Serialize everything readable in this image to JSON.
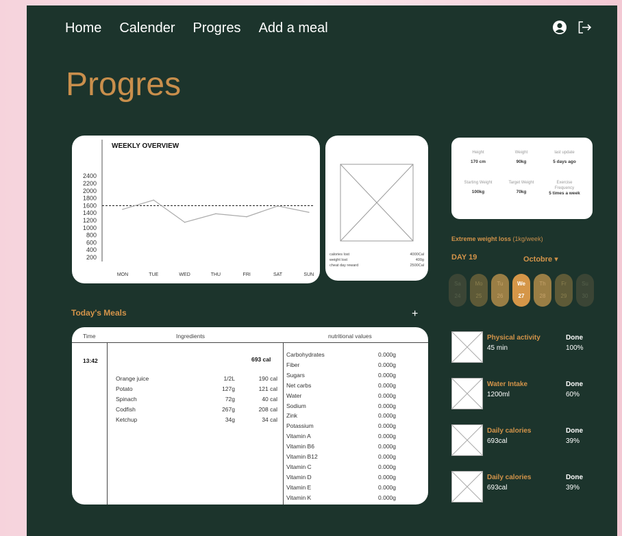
{
  "nav": {
    "items": [
      "Home",
      "Calender",
      "Progres",
      "Add a meal"
    ],
    "user_icon": "user-circle-icon",
    "logout_icon": "logout-icon"
  },
  "page_title": "Progres",
  "chart_data": {
    "type": "line",
    "title": "WEEKLY OVERVIEW",
    "categories": [
      "MON",
      "TUE",
      "WED",
      "THU",
      "FRI",
      "SAT",
      "SUN"
    ],
    "series": [
      {
        "values": [
          1500,
          1750,
          1150,
          1380,
          1300,
          1590,
          1420
        ]
      }
    ],
    "reference_line": 1600,
    "yticks": [
      200,
      400,
      600,
      800,
      1000,
      1200,
      1400,
      1600,
      1800,
      2000,
      2200,
      2400
    ],
    "ylim": [
      0,
      2400
    ]
  },
  "summary": {
    "rows": [
      {
        "label": "calories lost",
        "value": "4000Cal"
      },
      {
        "label": "weight lost",
        "value": "400g"
      },
      {
        "label": "cheat day reward",
        "value": "2500Cal"
      }
    ]
  },
  "stats": {
    "height_label": "Height",
    "height": "170 cm",
    "weight_label": "Weight",
    "weight": "90kg",
    "update_label": "last update",
    "update": "5 days ago",
    "start_label": "Starting Weight",
    "start": "100kg",
    "target_label": "Target Weight",
    "target": "70kg",
    "freq_label": "Exercise Frequency",
    "freq": "5 times a week"
  },
  "plan": {
    "name": "Extreme weight loss",
    "rate": "(1kg/week)",
    "day": "DAY 19",
    "month": "Octobre ▾",
    "days": [
      {
        "d": "Sa",
        "n": "24"
      },
      {
        "d": "Mo",
        "n": "25"
      },
      {
        "d": "Tu",
        "n": "26"
      },
      {
        "d": "We",
        "n": "27"
      },
      {
        "d": "Th",
        "n": "28"
      },
      {
        "d": "Fr",
        "n": "29"
      },
      {
        "d": "Su",
        "n": "30"
      }
    ]
  },
  "meals": {
    "title": "Today's Meals",
    "add": "+",
    "headers": {
      "time": "Time",
      "ingredients": "Ingredients",
      "nutrition": "nutritional values"
    },
    "time": "13:42",
    "total": "693 cal",
    "ingredients": [
      {
        "name": "Orange juice",
        "qty": "1/2L",
        "cal": "190 cal"
      },
      {
        "name": "Potato",
        "qty": "127g",
        "cal": "121 cal"
      },
      {
        "name": "Spinach",
        "qty": "72g",
        "cal": "40 cal"
      },
      {
        "name": "Codfish",
        "qty": "267g",
        "cal": "208 cal"
      },
      {
        "name": "Ketchup",
        "qty": "34g",
        "cal": "34 cal"
      }
    ],
    "nutrients": [
      {
        "name": "Carbohydrates",
        "value": "0.000g"
      },
      {
        "name": "Fiber",
        "value": "0.000g"
      },
      {
        "name": "Sugars",
        "value": "0.000g"
      },
      {
        "name": "Net carbs",
        "value": "0.000g"
      },
      {
        "name": "Water",
        "value": "0.000g"
      },
      {
        "name": "Sodium",
        "value": "0.000g"
      },
      {
        "name": "Zink",
        "value": "0.000g"
      },
      {
        "name": "Potassium",
        "value": "0.000g"
      },
      {
        "name": "Vitamin A",
        "value": "0.000g"
      },
      {
        "name": "Vitamin B6",
        "value": "0.000g"
      },
      {
        "name": "Vitamin B12",
        "value": "0.000g"
      },
      {
        "name": "Vitamin C",
        "value": "0.000g"
      },
      {
        "name": "Vitamin D",
        "value": "0.000g"
      },
      {
        "name": "Vitamin E",
        "value": "0.000g"
      },
      {
        "name": "Vitamin K",
        "value": "0.000g"
      }
    ]
  },
  "activities": [
    {
      "name": "Physical activity",
      "value": "45 min",
      "status": "Done",
      "pct": "100%"
    },
    {
      "name": "Water Intake",
      "value": "1200ml",
      "status": "Done",
      "pct": "60%"
    },
    {
      "name": "Daily calories",
      "value": "693cal",
      "status": "Done",
      "pct": "39%"
    },
    {
      "name": "Daily calories",
      "value": "693cal",
      "status": "Done",
      "pct": "39%"
    }
  ]
}
